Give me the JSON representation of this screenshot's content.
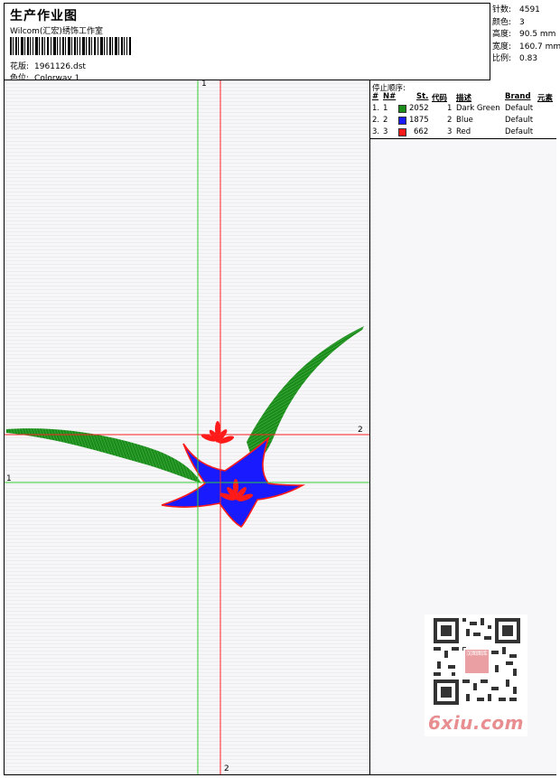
{
  "header": {
    "title": "生产作业图",
    "company": "Wilcom(汇宏)绣饰工作室",
    "design_label": "花版:",
    "design_file": "1961126.dst",
    "color_label": "色位:",
    "colorway": "Colorway 1"
  },
  "stats": {
    "stitches_label": "针数:",
    "stitches": "4591",
    "colors_label": "颜色:",
    "colors": "3",
    "height_label": "高度:",
    "height": "90.5 mm",
    "width_label": "宽度:",
    "width": "160.7 mm",
    "scale_label": "比例:",
    "scale": "0.83"
  },
  "stop_sequence": {
    "title": "停止顺序:",
    "headers": {
      "hash": "#",
      "n": "N#",
      "st": "St.",
      "code": "代码",
      "desc": "描述",
      "brand": "Brand",
      "elem": "元素"
    },
    "rows": [
      {
        "idx": "1.",
        "n": "1",
        "color": "#1a8c1a",
        "st": "2052",
        "code": "1",
        "desc": "Dark Green",
        "brand": "Default"
      },
      {
        "idx": "2.",
        "n": "2",
        "color": "#1a1aff",
        "st": "1875",
        "code": "2",
        "desc": "Blue",
        "brand": "Default"
      },
      {
        "idx": "3.",
        "n": "3",
        "color": "#ff1a1a",
        "st": "662",
        "code": "3",
        "desc": "Red",
        "brand": "Default"
      }
    ]
  },
  "guides": {
    "green_label_top": "1",
    "green_label_left": "1",
    "red_label_right": "2",
    "red_label_bottom": "2"
  },
  "watermark": {
    "text": "6xiu.com",
    "stamp": "汉图图库"
  },
  "colors": {
    "green": "#1a8c1a",
    "blue": "#1a1aff",
    "red": "#ff1a1a",
    "green_guide": "#33cc33",
    "red_guide": "#ff2020"
  }
}
